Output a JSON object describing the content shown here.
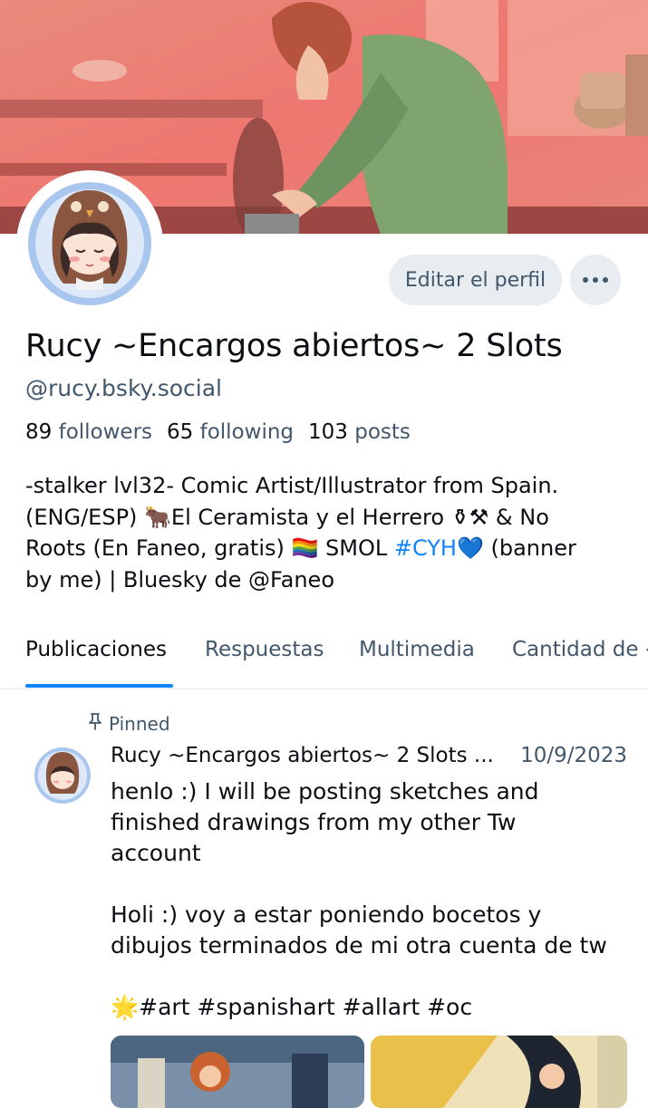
{
  "profile": {
    "display_name": "Rucy ~Encargos abiertos~ 2 Slots",
    "handle": "@rucy.bsky.social",
    "stats": {
      "followers_count": "89",
      "followers_label": "followers",
      "following_count": "65",
      "following_label": "following",
      "posts_count": "103",
      "posts_label": "posts"
    },
    "bio": {
      "line1": "-stalker lvl32- Comic Artist/Illustrator from Spain.",
      "line2a": "(ENG/ESP) 🐂El Ceramista y el Herrero ⚱⚒ & No",
      "line3a": "Roots (En Faneo, gratis) 🏳️‍🌈 SMOL ",
      "line3_tag": "#CYH",
      "line3b": "💙 (banner",
      "line4": "by me) | Bluesky de @Faneo"
    }
  },
  "buttons": {
    "edit_profile": "Editar el perfil"
  },
  "tabs": [
    {
      "label": "Publicaciones",
      "active": true
    },
    {
      "label": "Respuestas",
      "active": false
    },
    {
      "label": "Multimedia",
      "active": false
    },
    {
      "label": "Cantidad de ‹",
      "active": false
    }
  ],
  "post": {
    "pinned_label": "Pinned",
    "author": "Rucy ~Encargos abiertos~ 2 Slots ...",
    "date": "10/9/2023",
    "text_lines": [
      "henlo :) I will be posting sketches and",
      "finished drawings from my other Tw",
      "account",
      "",
      "Holi :) voy a estar poniendo bocetos y",
      "dibujos terminados de mi otra cuenta de tw",
      "",
      "🌟#art #spanishart #allart #oc"
    ]
  },
  "icons": {
    "pin": "pin-icon",
    "more": "more-options-icon"
  },
  "colors": {
    "accent": "#1083fe",
    "muted_text": "#42576c",
    "button_bg": "#e8edf1"
  }
}
